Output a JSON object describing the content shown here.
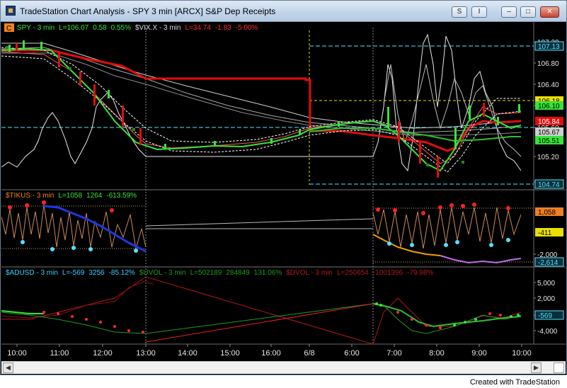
{
  "window": {
    "title": "TradeStation Chart Analysis - SPY 3 min [ARCX] S&P Dep Receipts",
    "controls": [
      "S",
      "I",
      "–",
      "□",
      "✕"
    ]
  },
  "panes": {
    "price": {
      "corner_badge": "C",
      "legend": [
        {
          "text": "SPY - 3 min",
          "color": "#34e834"
        },
        {
          "text": "L=106.07",
          "color": "#34e834"
        },
        {
          "text": "0.58",
          "color": "#34e834"
        },
        {
          "text": "0.55%",
          "color": "#34e834"
        },
        {
          "text": "$VIX.X - 3 min",
          "color": "#d9d9d9"
        },
        {
          "text": "L=34.74",
          "color": "#ff2a2a"
        },
        {
          "text": "-1.83",
          "color": "#ff2a2a"
        },
        {
          "text": "-5.00%",
          "color": "#ff2a2a"
        }
      ],
      "axis_ticks": [
        "107.20",
        "106.80",
        "106.40",
        "106.00",
        "105.60",
        "105.20",
        "104.80"
      ],
      "tags": [
        {
          "text": "107.13",
          "bg": "#0b2e3a",
          "fg": "#4fe3ff"
        },
        {
          "text": "106.18",
          "bg": "#e8e000",
          "fg": "#000000"
        },
        {
          "text": "106.10",
          "bg": "#37e437",
          "fg": "#000000"
        },
        {
          "text": "105.84",
          "bg": "#e20d0d",
          "fg": "#ffffff"
        },
        {
          "text": "105.67",
          "bg": "#cfcfcf",
          "fg": "#000000"
        },
        {
          "text": "105.51",
          "bg": "#37e437",
          "fg": "#000000"
        },
        {
          "text": "104.74",
          "bg": "#0b2e3a",
          "fg": "#4fe3ff"
        }
      ]
    },
    "tikus": {
      "legend": [
        {
          "text": "$TIKUS - 3 min",
          "color": "#f08020"
        },
        {
          "text": "L=1058",
          "color": "#34e834"
        },
        {
          "text": "1264",
          "color": "#34e834"
        },
        {
          "text": "-613.59%",
          "color": "#34e834"
        }
      ],
      "axis_ticks": [
        "-2,000"
      ],
      "tags": [
        {
          "text": "1,058",
          "bg": "#f08020",
          "fg": "#000000"
        },
        {
          "text": "-411",
          "bg": "#e8e000",
          "fg": "#000000"
        },
        {
          "text": "-2,614",
          "bg": "#0b2e3a",
          "fg": "#4fe3ff"
        }
      ]
    },
    "adusd": {
      "legend": [
        {
          "text": "$ADUSD - 3 min",
          "color": "#2fd6ff"
        },
        {
          "text": "L=-569",
          "color": "#2fd6ff"
        },
        {
          "text": "3256",
          "color": "#2fd6ff"
        },
        {
          "text": "-85.12%",
          "color": "#2fd6ff"
        },
        {
          "text": "$UVOL - 3 min",
          "color": "#1f9a1f"
        },
        {
          "text": "L=502189",
          "color": "#1f9a1f"
        },
        {
          "text": "284849",
          "color": "#1f9a1f"
        },
        {
          "text": "131.06%",
          "color": "#1f9a1f"
        },
        {
          "text": "$DVOL - 3 min",
          "color": "#b01818"
        },
        {
          "text": "L=250654",
          "color": "#b01818"
        },
        {
          "text": "-1001396",
          "color": "#b01818"
        },
        {
          "text": "-79.98%",
          "color": "#b01818"
        }
      ],
      "axis_ticks": [
        "5,000",
        "2,000",
        "-1,000",
        "-4,000"
      ],
      "tags": [
        {
          "text": "-569",
          "bg": "#0b2e3a",
          "fg": "#4fe3ff"
        }
      ]
    }
  },
  "time_axis": [
    "10:00",
    "11:00",
    "12:00",
    "13:00",
    "14:00",
    "15:00",
    "16:00",
    "6/8",
    "6:00",
    "7:00",
    "8:00",
    "9:00",
    "10:00"
  ],
  "footer": "Created with TradeStation"
}
